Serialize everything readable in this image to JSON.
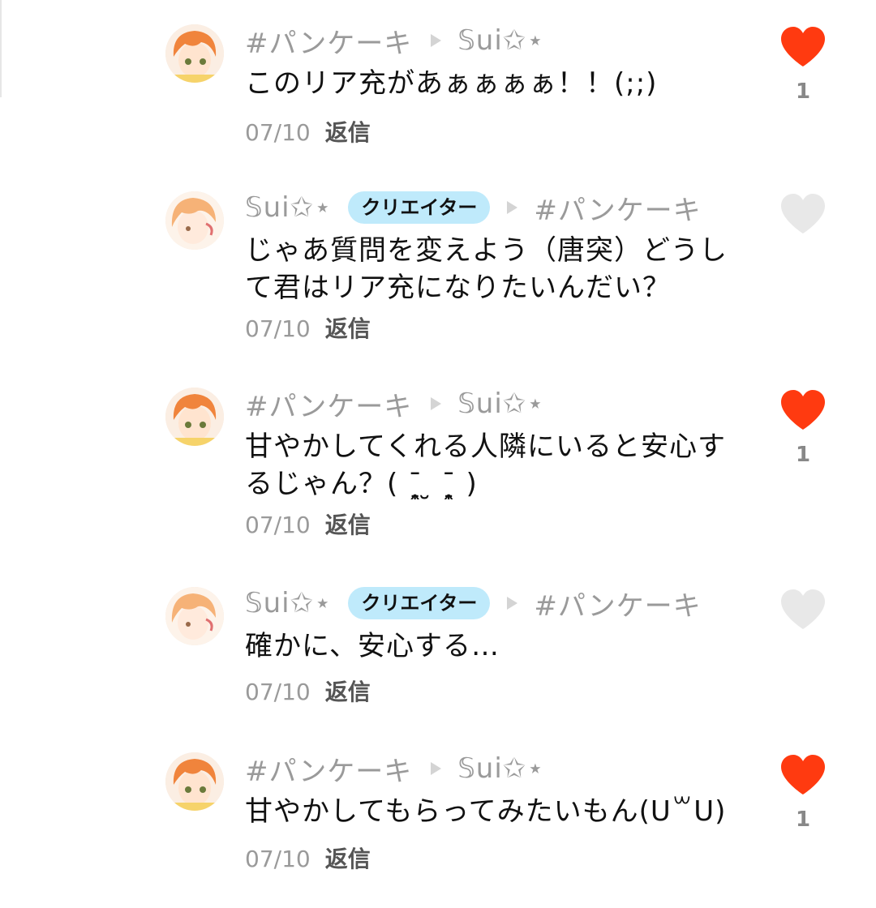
{
  "colors": {
    "like_active": "#ff3a10",
    "like_inactive": "#e8e8e8",
    "badge_bg": "#bfeafb",
    "name_gray": "#9a9a9a",
    "reply_gray": "#555555"
  },
  "comments": [
    {
      "author": "#パンケーキ",
      "reply_to": "𝕊ui✩⋆",
      "text": "このリア充があぁぁぁぁ！！(;;)",
      "date": "07/10",
      "reply_label": "返信",
      "liked": true,
      "like_count": "1",
      "avatar": "orange-hair-avatar"
    },
    {
      "author": "𝕊ui✩⋆",
      "badge": "クリエイター",
      "reply_to": "#パンケーキ",
      "text": "じゃあ質問を変えよう（唐突）どうして君はリア充になりたいんだい？",
      "date": "07/10",
      "reply_label": "返信",
      "liked": false,
      "like_count": "",
      "avatar": "light-hair-avatar"
    },
    {
      "author": "#パンケーキ",
      "reply_to": "𝕊ui✩⋆",
      "text": "甘やかしてくれる人隣にいると安心するじゃん？( ˉ̞̭ ̮ ˉ̞̭ )",
      "date": "07/10",
      "reply_label": "返信",
      "liked": true,
      "like_count": "1",
      "avatar": "orange-hair-avatar"
    },
    {
      "author": "𝕊ui✩⋆",
      "badge": "クリエイター",
      "reply_to": "#パンケーキ",
      "text": "確かに、安心する…",
      "date": "07/10",
      "reply_label": "返信",
      "liked": false,
      "like_count": "",
      "avatar": "light-hair-avatar"
    },
    {
      "author": "#パンケーキ",
      "reply_to": "𝕊ui✩⋆",
      "text": "甘やかしてもらってみたいもん(ᑌ꒳ᑌ)",
      "date": "07/10",
      "reply_label": "返信",
      "liked": true,
      "like_count": "1",
      "avatar": "orange-hair-avatar"
    }
  ]
}
